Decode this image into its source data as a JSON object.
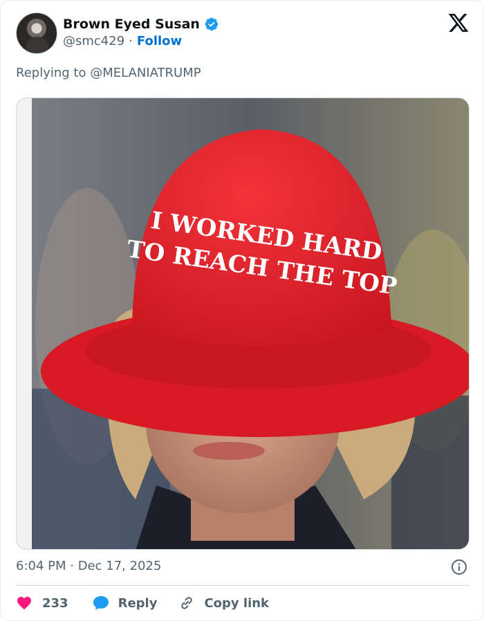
{
  "author": {
    "name": "Brown Eyed Susan",
    "handle": "@smc429",
    "separator": "·",
    "follow_label": "Follow",
    "verified": true
  },
  "replying_to": "Replying to @MELANIATRUMP",
  "media": {
    "hat_text_line1": "I WORKED HARD",
    "hat_text_line2": "TO REACH THE TOP",
    "hat_color": "#e8232b"
  },
  "timestamp": "6:04 PM · Dec 17, 2025",
  "actions": {
    "like_count": "233",
    "reply_label": "Reply",
    "copy_label": "Copy link"
  },
  "colors": {
    "like": "#f91880",
    "reply": "#1d9bf0",
    "link_blue": "#006fd6",
    "muted": "#536471"
  },
  "icons": [
    "verified-badge-icon",
    "x-logo-icon",
    "info-icon",
    "heart-icon",
    "reply-bubble-icon",
    "link-icon"
  ]
}
